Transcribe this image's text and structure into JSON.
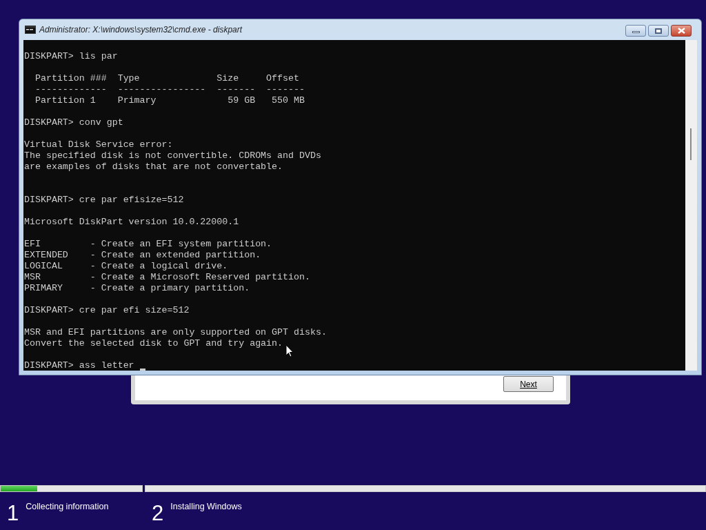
{
  "setup_dialog": {
    "next_button": "Next"
  },
  "console_window": {
    "title": "Administrator: X:\\windows\\system32\\cmd.exe - diskpart",
    "blocks": [
      {
        "kind": "command",
        "lines": [
          "DISKPART> lis par"
        ]
      },
      {
        "kind": "output",
        "lines": [
          "  Partition ###  Type              Size     Offset",
          "  -------------  ----------------  -------  -------",
          "  Partition 1    Primary             59 GB   550 MB"
        ]
      },
      {
        "kind": "command",
        "lines": [
          "DISKPART> conv gpt"
        ]
      },
      {
        "kind": "error",
        "lines": [
          "Virtual Disk Service error:",
          "The specified disk is not convertible. CDROMs and DVDs",
          "are examples of disks that are not convertable."
        ]
      },
      {
        "kind": "command",
        "lines": [
          "DISKPART> cre par efisize=512"
        ]
      },
      {
        "kind": "output",
        "lines": [
          "Microsoft DiskPart version 10.0.22000.1"
        ]
      },
      {
        "kind": "output",
        "lines": [
          "EFI         - Create an EFI system partition.",
          "EXTENDED    - Create an extended partition.",
          "LOGICAL     - Create a logical drive.",
          "MSR         - Create a Microsoft Reserved partition.",
          "PRIMARY     - Create a primary partition."
        ]
      },
      {
        "kind": "command",
        "lines": [
          "DISKPART> cre par efi size=512"
        ]
      },
      {
        "kind": "output",
        "lines": [
          "MSR and EFI partitions are only supported on GPT disks.",
          "Convert the selected disk to GPT and try again."
        ]
      },
      {
        "kind": "prompt",
        "lines": [
          "DISKPART> ass letter "
        ]
      }
    ]
  },
  "progress_steps": [
    {
      "number": "1",
      "label": "Collecting information",
      "level": 0.26
    },
    {
      "number": "2",
      "label": "Installing Windows"
    }
  ]
}
